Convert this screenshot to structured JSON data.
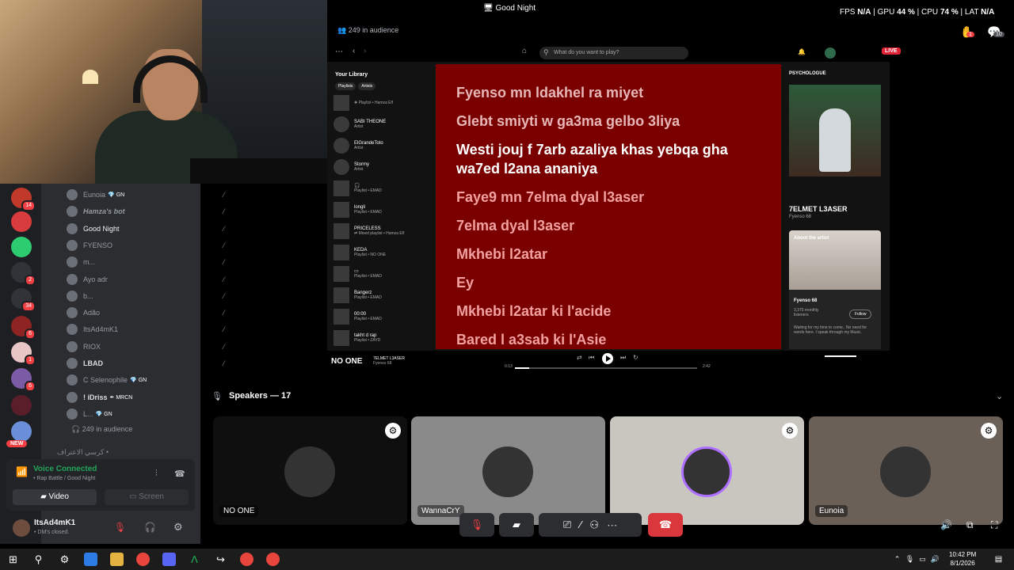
{
  "stream_title": "Good Night",
  "stats": {
    "fps_label": "FPS",
    "fps": "N/A",
    "gpu_label": "GPU",
    "gpu": "44 %",
    "cpu_label": "CPU",
    "cpu": "74 %",
    "lat_label": "LAT",
    "lat": "N/A"
  },
  "audience_top": "249 in audience",
  "notif": {
    "hand_count": "1",
    "chat_count": "10"
  },
  "spotify": {
    "search_placeholder": "What do you want to play?",
    "live": "LIVE",
    "library_title": "Your Library",
    "chips": [
      "Playlists",
      "Artists"
    ],
    "library": [
      {
        "title": "",
        "sub": "✚ Playlist • Hamza Elf"
      },
      {
        "title": "SABI THEONE",
        "sub": "Artist"
      },
      {
        "title": "ElGrandeToto",
        "sub": "Artist"
      },
      {
        "title": "Stormy",
        "sub": "Artist"
      },
      {
        "title": "🎧",
        "sub": "Playlist • EMAD"
      },
      {
        "title": "longli",
        "sub": "Playlist • EMAD"
      },
      {
        "title": "PRICELESS",
        "sub": "⇄ Mixed playlist • Hamza Elf"
      },
      {
        "title": "KEDA",
        "sub": "Playlist • NO ONE"
      },
      {
        "title": "▭",
        "sub": "Playlist • EMAD"
      },
      {
        "title": "Bangerz",
        "sub": "Playlist • EMAD"
      },
      {
        "title": "00:00",
        "sub": "Playlist • EMAD"
      },
      {
        "title": "takht d rap",
        "sub": "Playlist • ZAYD"
      }
    ],
    "lyrics": [
      "Fyenso mn ldakhel ra miyet",
      "Glebt smiyti w ga3ma gelbo 3liya",
      "Westi jouj f 7arb azaliya khas yebqa gha wa7ed l2ana ananiya",
      "Faye9 mn 7elma dyal l3aser",
      "7elma dyal l3aser",
      "Mkhebi l2atar",
      "Ey",
      "Mkhebi l2atar ki l'acide",
      "Bared l a3sab ki l'Asie"
    ],
    "panel_label": "PSYCHOLOGUE",
    "track_title": "7ELMET L3ASER",
    "track_artist": "Fyenso 68",
    "about_label": "About the artist",
    "artist_name": "Fyenso 68",
    "monthly": "3,375 monthly listeners",
    "follow": "Follow",
    "bio": "Waiting for my time to come.. No need for words here. I speak through my Music.",
    "now_playing_name": "NO ONE",
    "song_small": "7ELMET L3ASER",
    "song_small_artist": "Fyenso 68",
    "time_elapsed": "0:13",
    "time_total": "2:42",
    "progress": 0.08
  },
  "servers": [
    {
      "badge": "14",
      "color": "#c0392b"
    },
    {
      "badge": "",
      "color": "#d83c3e"
    },
    {
      "badge": "",
      "color": "#2ecc71"
    },
    {
      "badge": "2",
      "color": "#313338"
    },
    {
      "badge": "34",
      "color": "#313338"
    },
    {
      "badge": "6",
      "color": "#8e2323"
    },
    {
      "badge": "1",
      "color": "#e8c6c6"
    },
    {
      "badge": "6",
      "color": "#7b5aa6"
    },
    {
      "badge": "",
      "color": "#5a1e2b"
    },
    {
      "badge": "",
      "color": "#6a8fd8"
    }
  ],
  "new_label": "NEW",
  "members": [
    {
      "name": "Eunoia",
      "tag": "💎 GN",
      "style": "dim"
    },
    {
      "name": "Hamza's bot",
      "tag": "",
      "style": "italic"
    },
    {
      "name": "Good Night",
      "tag": "",
      "style": "hi"
    },
    {
      "name": "FYENSO",
      "tag": "",
      "style": "dim"
    },
    {
      "name": "m...",
      "tag": "",
      "style": "dim"
    },
    {
      "name": "Ayo adr",
      "tag": "",
      "style": "dim"
    },
    {
      "name": "b...",
      "tag": "",
      "style": "dim"
    },
    {
      "name": "Adão",
      "tag": "",
      "style": "dim"
    },
    {
      "name": "ItsAd4mK1",
      "tag": "",
      "style": "dim"
    },
    {
      "name": "RIOX",
      "tag": "",
      "style": "dim"
    },
    {
      "name": "LBAD",
      "tag": "",
      "style": "bold"
    },
    {
      "name": "C Selenophile",
      "tag": "💎 GN",
      "style": "dim"
    },
    {
      "name": "! iDriss",
      "tag": "✒ MRCN",
      "style": "bold"
    },
    {
      "name": "L...",
      "tag": "💎 GN",
      "style": "dim"
    }
  ],
  "audience_list": "249 in audience",
  "forum_label": "كرسي الاعتراف •",
  "voice": {
    "status": "Voice Connected",
    "sub": "• Rap Battle / Good Night",
    "video": "Video",
    "screen": "Screen"
  },
  "user": {
    "name": "ItsAd4mK1",
    "status": "• DM's closed."
  },
  "stage": {
    "speakers": "Speakers — 17",
    "tiles": [
      {
        "name": "NO ONE",
        "bg": "#0f0f0f"
      },
      {
        "name": "WannaCrY",
        "bg": "#8a8a8a"
      },
      {
        "name": "",
        "bg": "#c9c6c0"
      },
      {
        "name": "Eunoia",
        "bg": "#6b6058"
      }
    ]
  },
  "clock": {
    "time": "10:42 PM",
    "date": "8/1/2026"
  }
}
